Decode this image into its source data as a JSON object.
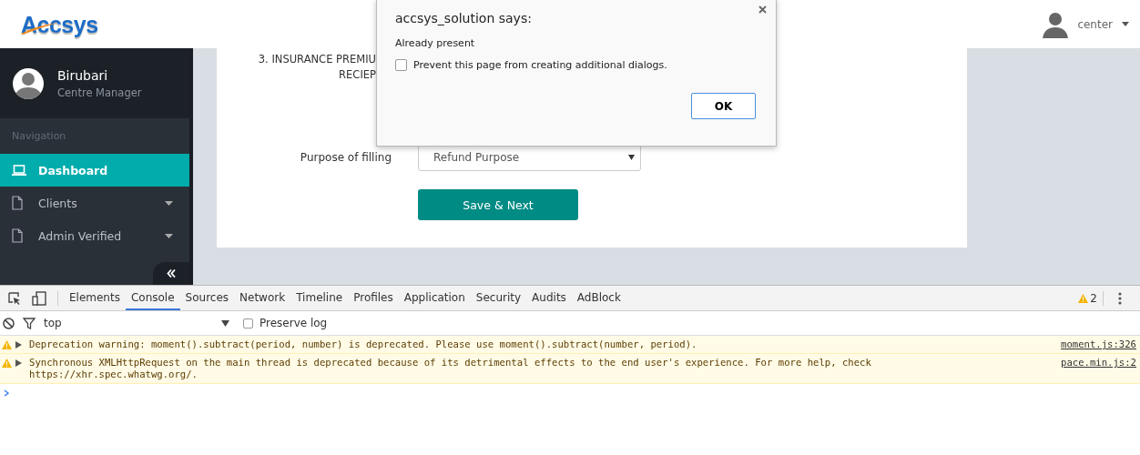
{
  "header": {
    "logo": "Accsys",
    "user": {
      "name": "center"
    }
  },
  "sidebar": {
    "profile": {
      "name": "Birubari",
      "role": "Centre Manager"
    },
    "section_label": "Navigation",
    "items": [
      {
        "label": "Dashboard",
        "kind": "link",
        "selected": true
      },
      {
        "label": "Clients",
        "kind": "dropdown",
        "selected": false
      },
      {
        "label": "Admin Verified",
        "kind": "dropdown",
        "selected": false
      }
    ]
  },
  "form": {
    "section_label": [
      "3. INSURANCE PREMIU",
      "RECIEP"
    ],
    "purpose": {
      "label": "Purpose of filling",
      "value": "Refund Purpose"
    },
    "submit": "Save & Next"
  },
  "dialog": {
    "title": "accsys_solution says:",
    "message": "Already present",
    "checkbox": {
      "label": "Prevent this page from creating additional dialogs.",
      "checked": false
    },
    "button": "OK"
  },
  "devtools": {
    "tabs": [
      {
        "label": "Elements",
        "selected": false
      },
      {
        "label": "Console",
        "selected": true
      },
      {
        "label": "Sources",
        "selected": false
      },
      {
        "label": "Network",
        "selected": false
      },
      {
        "label": "Timeline",
        "selected": false
      },
      {
        "label": "Profiles",
        "selected": false
      },
      {
        "label": "Application",
        "selected": false
      },
      {
        "label": "Security",
        "selected": false
      },
      {
        "label": "Audits",
        "selected": false
      },
      {
        "label": "AdBlock",
        "selected": false
      }
    ],
    "warning_count": "2",
    "context": "top",
    "preserve_log": {
      "label": "Preserve log",
      "checked": false
    },
    "messages": [
      {
        "kind": "warning",
        "text": "Deprecation warning: moment().subtract(period, number) is deprecated. Please use moment().subtract(number, period).",
        "source": "moment.js:326"
      },
      {
        "kind": "warning",
        "text": "Synchronous XMLHttpRequest on the main thread is deprecated because of its detrimental effects to the end user's experience. For more help, check https://xhr.spec.whatwg.org/.",
        "source": "pace.min.js:2"
      }
    ]
  }
}
